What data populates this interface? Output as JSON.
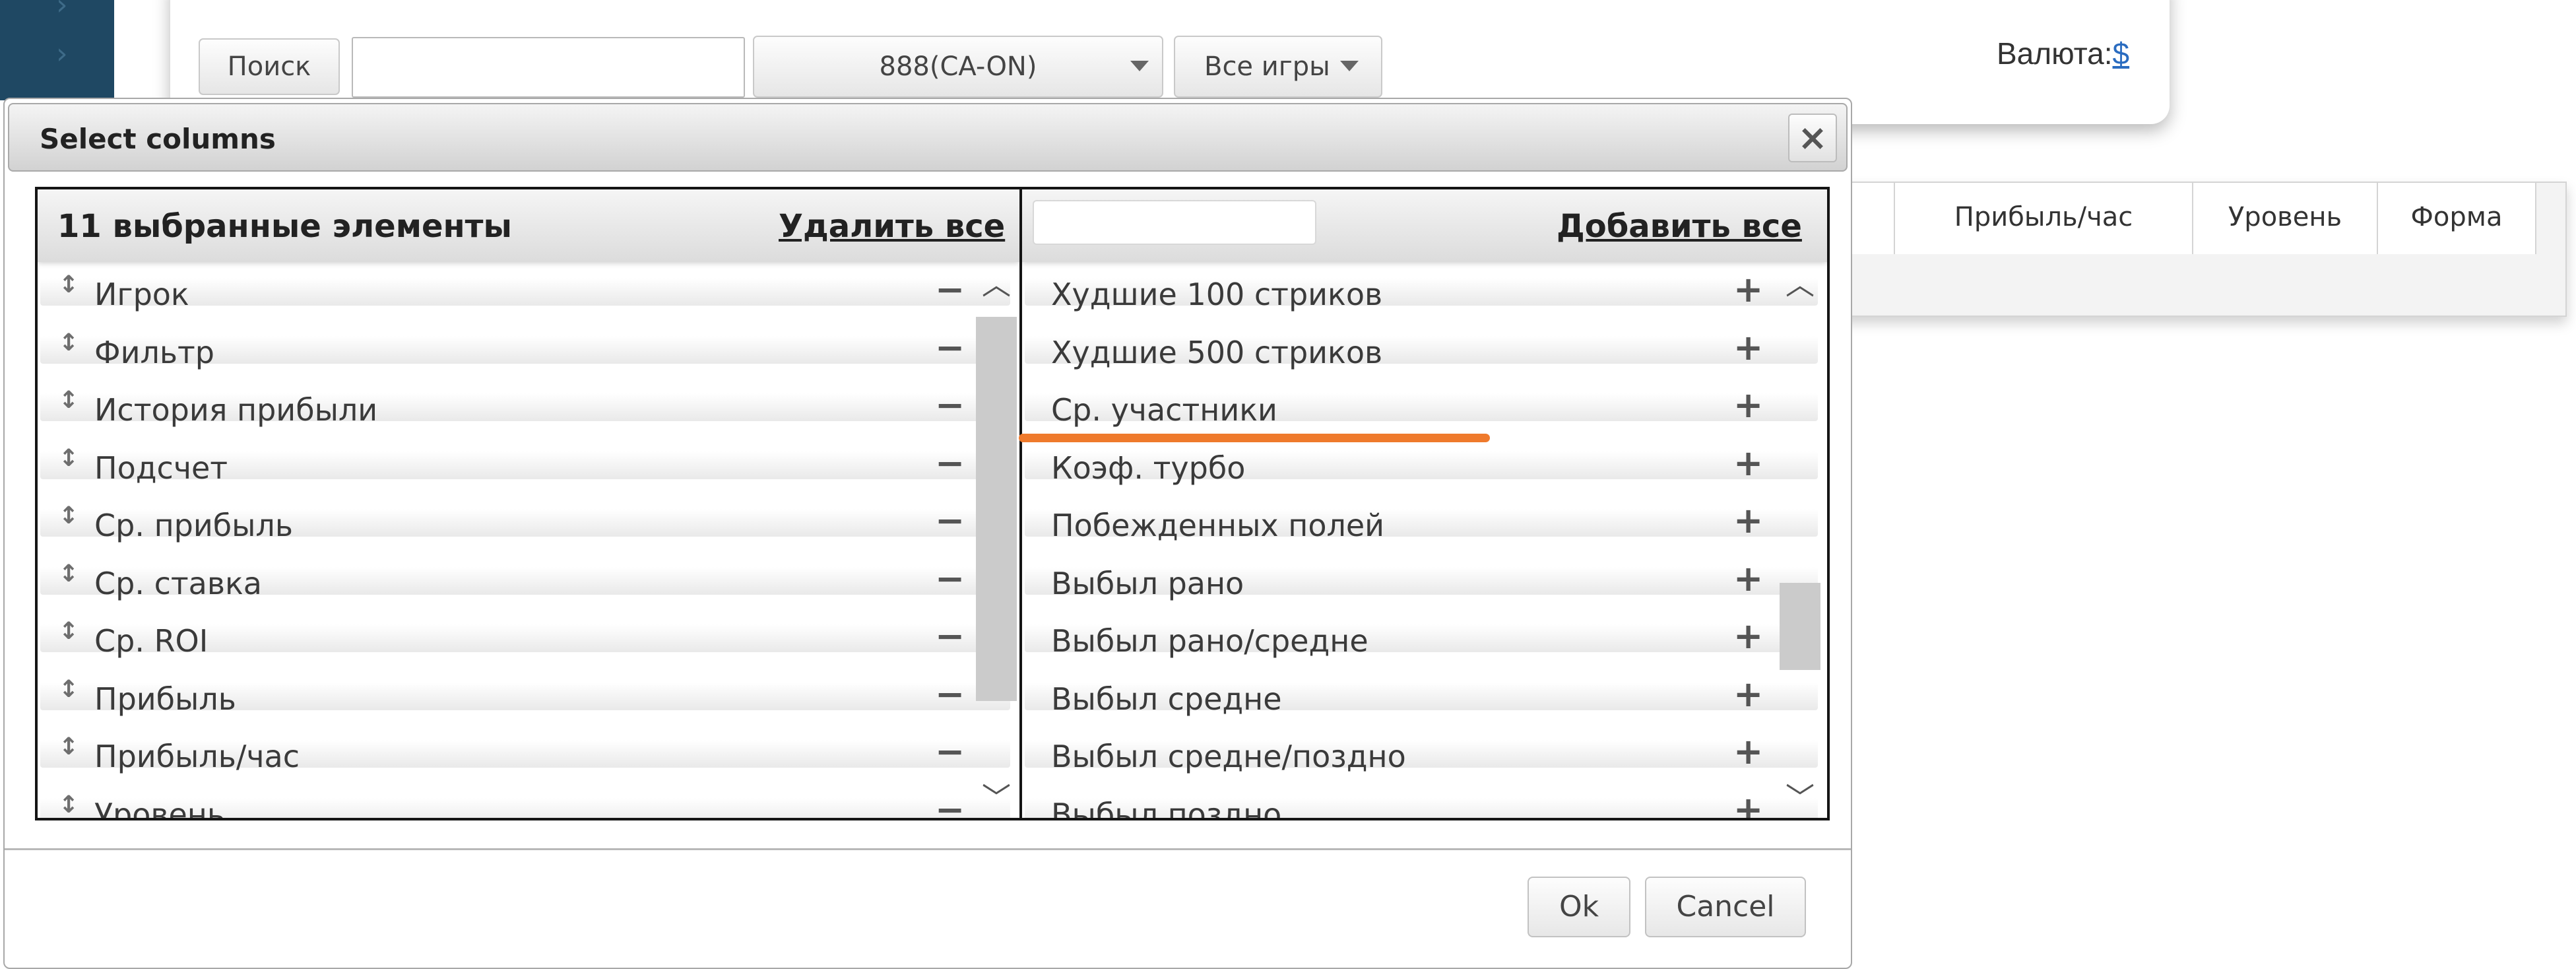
{
  "background": {
    "search_button": "Поиск",
    "search_value": "",
    "site_select": "888(CA-ON)",
    "games_select": "Все игры",
    "currency_label": "Валюта:",
    "currency_value": "$",
    "table_headers": [
      "Прибыль/час",
      "Уровень",
      "Форма"
    ]
  },
  "dialog": {
    "title": "Select columns",
    "close_symbol": "×",
    "selected": {
      "count_text": "11 выбранные элементы",
      "remove_all": "Удалить все",
      "items": [
        "Игрок",
        "Фильтр",
        "История прибыли",
        "Подсчет",
        "Ср. прибыль",
        "Ср. ставка",
        "Ср. ROI",
        "Прибыль",
        "Прибыль/час",
        "Уровень"
      ]
    },
    "available": {
      "search_value": "",
      "add_all": "Добавить все",
      "items": [
        "Худшие 100 стриков",
        "Худшие 500 стриков",
        "Ср. участники",
        "Коэф. турбо",
        "Побежденных полей",
        "Выбыл рано",
        "Выбыл рано/средне",
        "Выбыл средне",
        "Выбыл средне/поздно",
        "Выбыл поздно"
      ]
    },
    "ok_button": "Ok",
    "cancel_button": "Cancel"
  },
  "symbols": {
    "remove": "−",
    "add": "+",
    "drag": "↕",
    "scroll_up": "︿",
    "scroll_down": "﹀"
  },
  "colors": {
    "highlight": "#ef7a2c",
    "nav": "#1f4863",
    "link": "#2a6cc0"
  }
}
